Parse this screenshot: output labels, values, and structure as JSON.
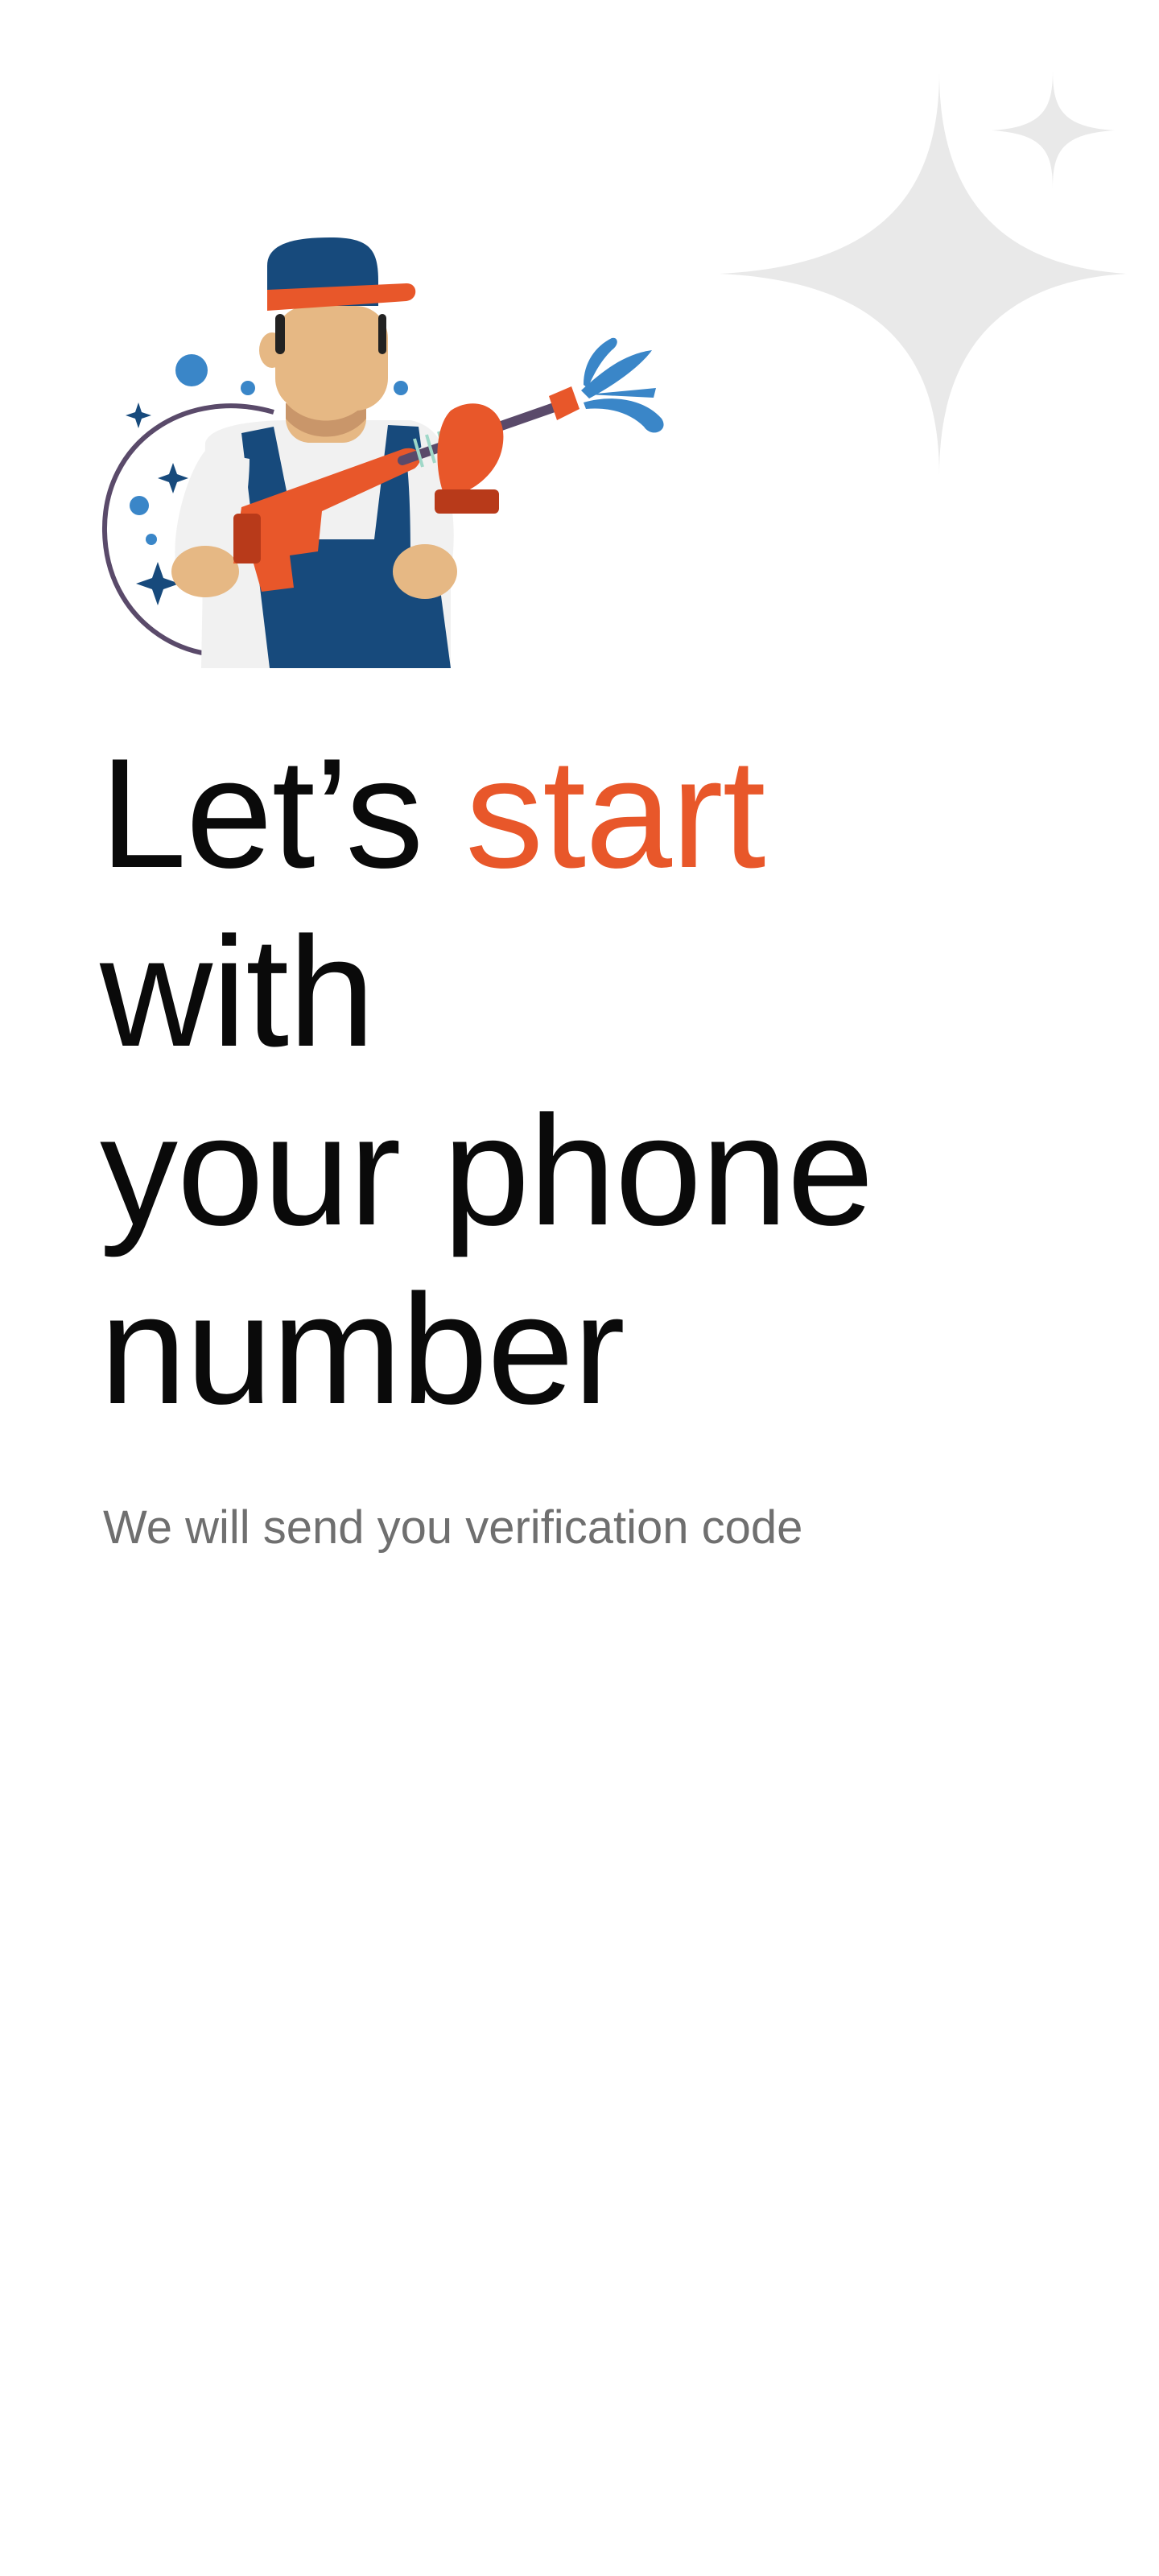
{
  "headline": {
    "part1": "Let’s ",
    "accent": "start",
    "line2": "with",
    "line3": "your phone",
    "line4": "number"
  },
  "subtitle": "We will send you verification code",
  "illustration": {
    "name": "cleaner-with-pressure-washer-illustration"
  },
  "decoration": {
    "name": "sparkle-icon"
  },
  "colors": {
    "accent": "#e8572a",
    "text": "#0a0a0a",
    "subtitle": "#6f6f6f",
    "sparkle": "#e9e9e9",
    "navy": "#174a7c",
    "water": "#3a86c8"
  }
}
